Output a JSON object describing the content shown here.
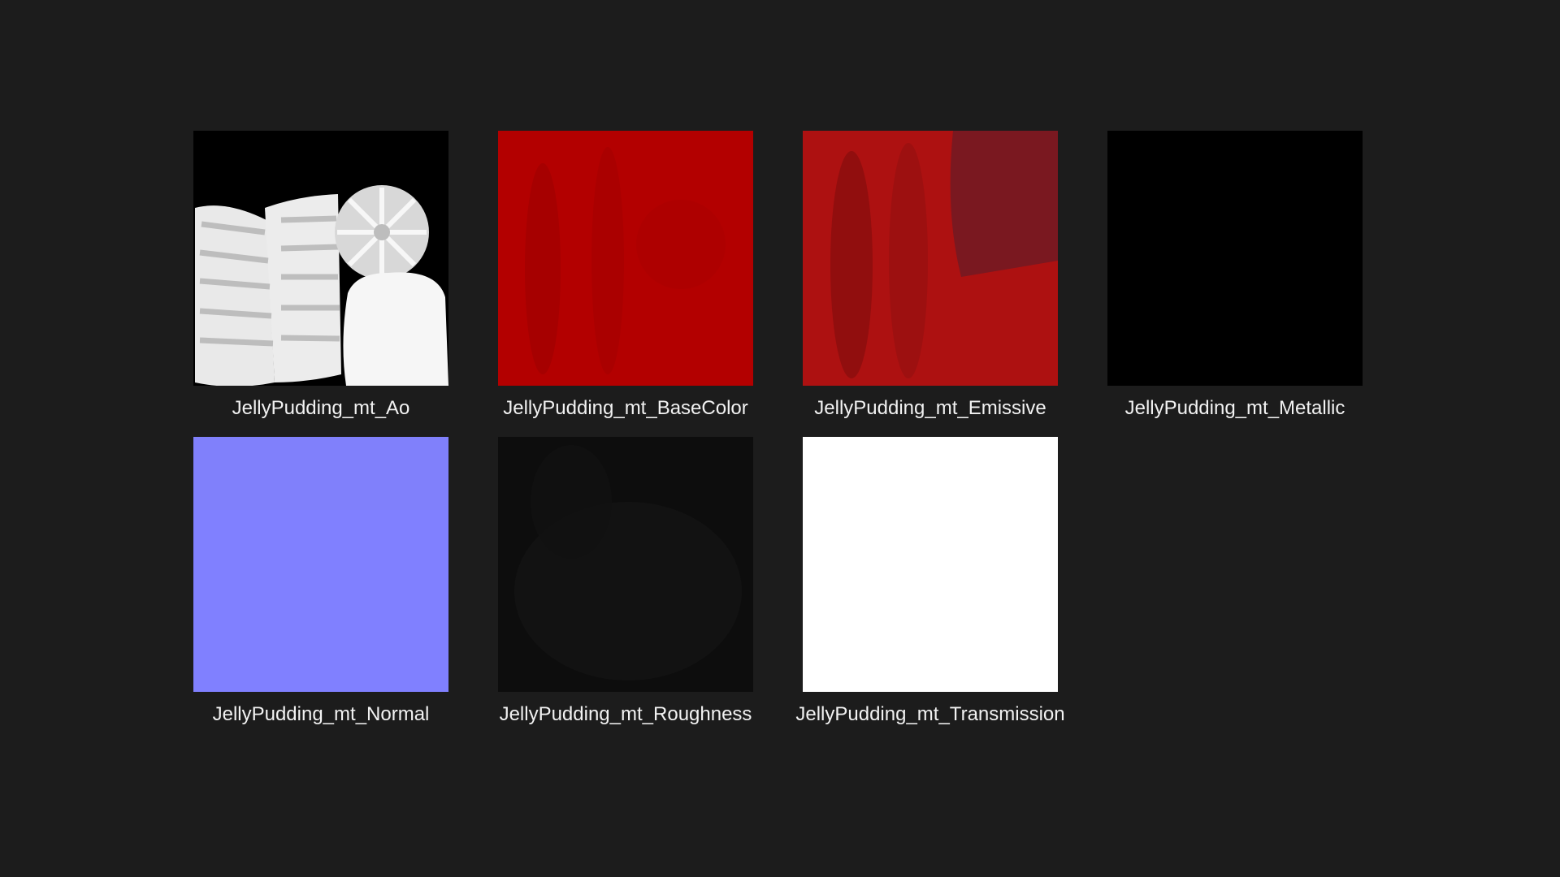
{
  "files": [
    {
      "name": "JellyPudding_mt_Ao",
      "icon": "ao-texture-thumbnail-icon"
    },
    {
      "name": "JellyPudding_mt_BaseColor",
      "icon": "basecolor-texture-thumbnail-icon",
      "color": "#b30000"
    },
    {
      "name": "JellyPudding_mt_Emissive",
      "icon": "emissive-texture-thumbnail-icon",
      "color": "#ad1111"
    },
    {
      "name": "JellyPudding_mt_Metallic",
      "icon": "metallic-texture-thumbnail-icon",
      "color": "#000000"
    },
    {
      "name": "JellyPudding_mt_Normal",
      "icon": "normal-texture-thumbnail-icon",
      "color": "#8080ff"
    },
    {
      "name": "JellyPudding_mt_Roughness",
      "icon": "roughness-texture-thumbnail-icon",
      "color": "#0d0d0d"
    },
    {
      "name": "JellyPudding_mt_Transmission",
      "icon": "transmission-texture-thumbnail-icon",
      "color": "#ffffff"
    }
  ],
  "colors": {
    "background": "#1c1c1c",
    "label": "#f2f2f2"
  }
}
